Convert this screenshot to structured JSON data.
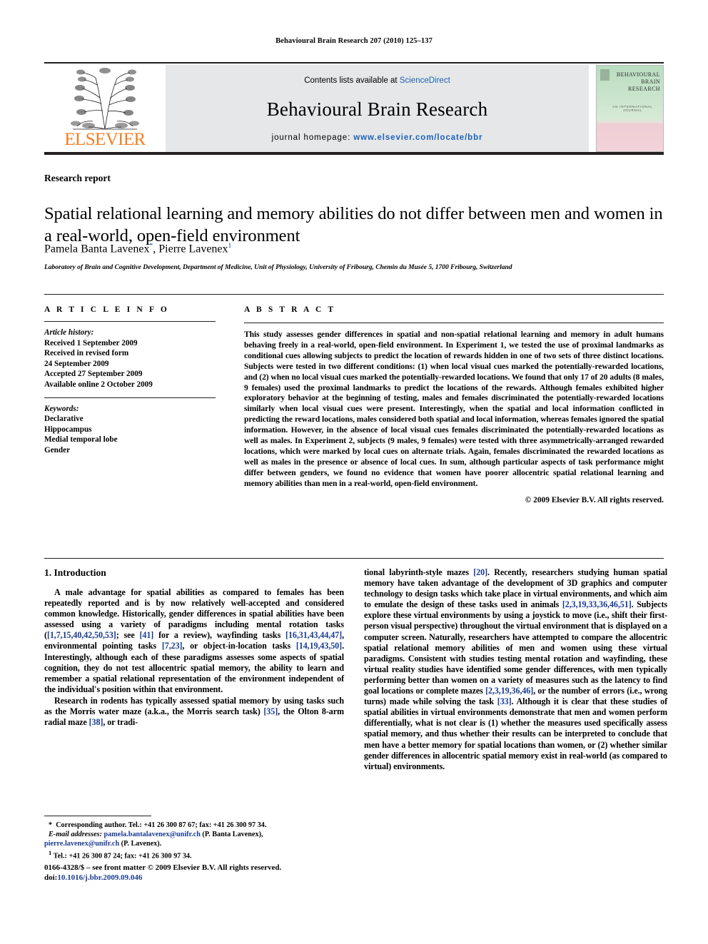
{
  "running_head": "Behavioural Brain Research 207 (2010) 125–137",
  "masthead": {
    "contents_prefix": "Contents lists available at ",
    "sciencedirect": "ScienceDirect",
    "journal_title": "Behavioural Brain Research",
    "homepage_prefix": "journal homepage: ",
    "homepage_url": "www.elsevier.com/locate/bbr",
    "publisher": "ELSEVIER",
    "cover_title": "BEHAVIOURAL BRAIN RESEARCH",
    "cover_subtitle": "AN INTERNATIONAL JOURNAL"
  },
  "article": {
    "type": "Research report",
    "title": "Spatial relational learning and memory abilities do not differ between men and women in a real-world, open-field environment",
    "authors_part1": "Pamela Banta Lavenex",
    "authors_star": "*",
    "authors_part2": ", Pierre Lavenex",
    "authors_sup": "1",
    "affiliation": "Laboratory of Brain and Cognitive Development, Department of Medicine, Unit of Physiology, University of Fribourg, Chemin du Musée 5, 1700 Fribourg, Switzerland"
  },
  "info": {
    "heading": "A R T I C L E    I N F O",
    "history_label": "Article history:",
    "history": [
      "Received 1 September 2009",
      "Received in revised form",
      "24 September 2009",
      "Accepted 27 September 2009",
      "Available online 2 October 2009"
    ],
    "keywords_label": "Keywords:",
    "keywords": [
      "Declarative",
      "Hippocampus",
      "Medial temporal lobe",
      "Gender"
    ]
  },
  "abstract": {
    "heading": "A B S T R A C T",
    "text": "This study assesses gender differences in spatial and non-spatial relational learning and memory in adult humans behaving freely in a real-world, open-field environment. In Experiment 1, we tested the use of proximal landmarks as conditional cues allowing subjects to predict the location of rewards hidden in one of two sets of three distinct locations. Subjects were tested in two different conditions: (1) when local visual cues marked the potentially-rewarded locations, and (2) when no local visual cues marked the potentially-rewarded locations. We found that only 17 of 20 adults (8 males, 9 females) used the proximal landmarks to predict the locations of the rewards. Although females exhibited higher exploratory behavior at the beginning of testing, males and females discriminated the potentially-rewarded locations similarly when local visual cues were present. Interestingly, when the spatial and local information conflicted in predicting the reward locations, males considered both spatial and local information, whereas females ignored the spatial information. However, in the absence of local visual cues females discriminated the potentially-rewarded locations as well as males. In Experiment 2, subjects (9 males, 9 females) were tested with three asymmetrically-arranged rewarded locations, which were marked by local cues on alternate trials. Again, females discriminated the rewarded locations as well as males in the presence or absence of local cues. In sum, although particular aspects of task performance might differ between genders, we found no evidence that women have poorer allocentric spatial relational learning and memory abilities than men in a real-world, open-field environment.",
    "copyright": "© 2009 Elsevier B.V. All rights reserved."
  },
  "body": {
    "section_heading": "1.  Introduction",
    "left_paragraph_1_a": "A male advantage for spatial abilities as compared to females has been repeatedly reported and is by now relatively well-accepted and considered common knowledge. Historically, gender differences in spatial abilities have been assessed using a variety of paradigms including mental rotation tasks (",
    "ref_1": "[1,7,15,40,42,50,53]",
    "left_paragraph_1_b": "; see ",
    "ref_2": "[41]",
    "left_paragraph_1_c": " for a review), wayfinding tasks ",
    "ref_3": "[16,31,43,44,47]",
    "left_paragraph_1_d": ", environmental pointing tasks ",
    "ref_4": "[7,23]",
    "left_paragraph_1_e": ", or object-in-location tasks ",
    "ref_5": "[14,19,43,50]",
    "left_paragraph_1_f": ". Interestingly, although each of these paradigms assesses some aspects of spatial cognition, they do not test allocentric spatial memory, the ability to learn and remember a spatial relational representation of the environment independent of the individual's position within that environment.",
    "left_paragraph_2_a": "Research in rodents has typically assessed spatial memory by using tasks such as the Morris water maze (a.k.a., the Morris search task) ",
    "ref_6": "[35]",
    "left_paragraph_2_b": ", the Olton 8-arm radial maze ",
    "ref_7": "[38]",
    "left_paragraph_2_c": ", or tradi-",
    "right_paragraph_a": "tional labyrinth-style mazes ",
    "ref_8": "[20]",
    "right_paragraph_b": ". Recently, researchers studying human spatial memory have taken advantage of the development of 3D graphics and computer technology to design tasks which take place in virtual environments, and which aim to emulate the design of these tasks used in animals ",
    "ref_9": "[2,3,19,33,36,46,51]",
    "right_paragraph_c": ". Subjects explore these virtual environments by using a joystick to move (i.e., shift their first-person visual perspective) throughout the virtual environment that is displayed on a computer screen. Naturally, researchers have attempted to compare the allocentric spatial relational memory abilities of men and women using these virtual paradigms. Consistent with studies testing mental rotation and wayfinding, these virtual reality studies have identified some gender differences, with men typically performing better than women on a variety of measures such as the latency to find goal locations or complete mazes ",
    "ref_10": "[2,3,19,36,46]",
    "right_paragraph_d": ", or the number of errors (i.e., wrong turns) made while solving the task ",
    "ref_11": "[33]",
    "right_paragraph_e": ". Although it is clear that these studies of spatial abilities in virtual environments demonstrate that men and women perform differentially, what is not clear is (1) whether the measures used specifically assess spatial memory, and thus whether their results can be interpreted to conclude that men have a better memory for spatial locations than women, or (2) whether similar gender differences in allocentric spatial memory exist in real-world (as compared to virtual) environments."
  },
  "footnotes": {
    "star": "*",
    "corresponding": "Corresponding author. Tel.: +41 26 300 87 67; fax: +41 26 300 97 34.",
    "email_label": "E-mail addresses:",
    "email_1": "pamela.bantalavenex@unifr.ch",
    "email_1_name": "(P. Banta Lavenex),",
    "email_2": "pierre.lavenex@unifr.ch",
    "email_2_name": "(P. Lavenex).",
    "sup_1": "1",
    "tel_1": "Tel.: +41 26 300 87 24; fax: +41 26 300 97 34."
  },
  "imprint": {
    "line1": "0166-4328/$ – see front matter © 2009 Elsevier B.V. All rights reserved.",
    "doi_label": "doi:",
    "doi_value": "10.1016/j.bbr.2009.09.046"
  },
  "colors": {
    "link_blue": "#1a62b6",
    "ref_blue": "#1a3b8f",
    "elsevier_orange": "#f57d20",
    "band_gray": "#e6e7e8"
  }
}
